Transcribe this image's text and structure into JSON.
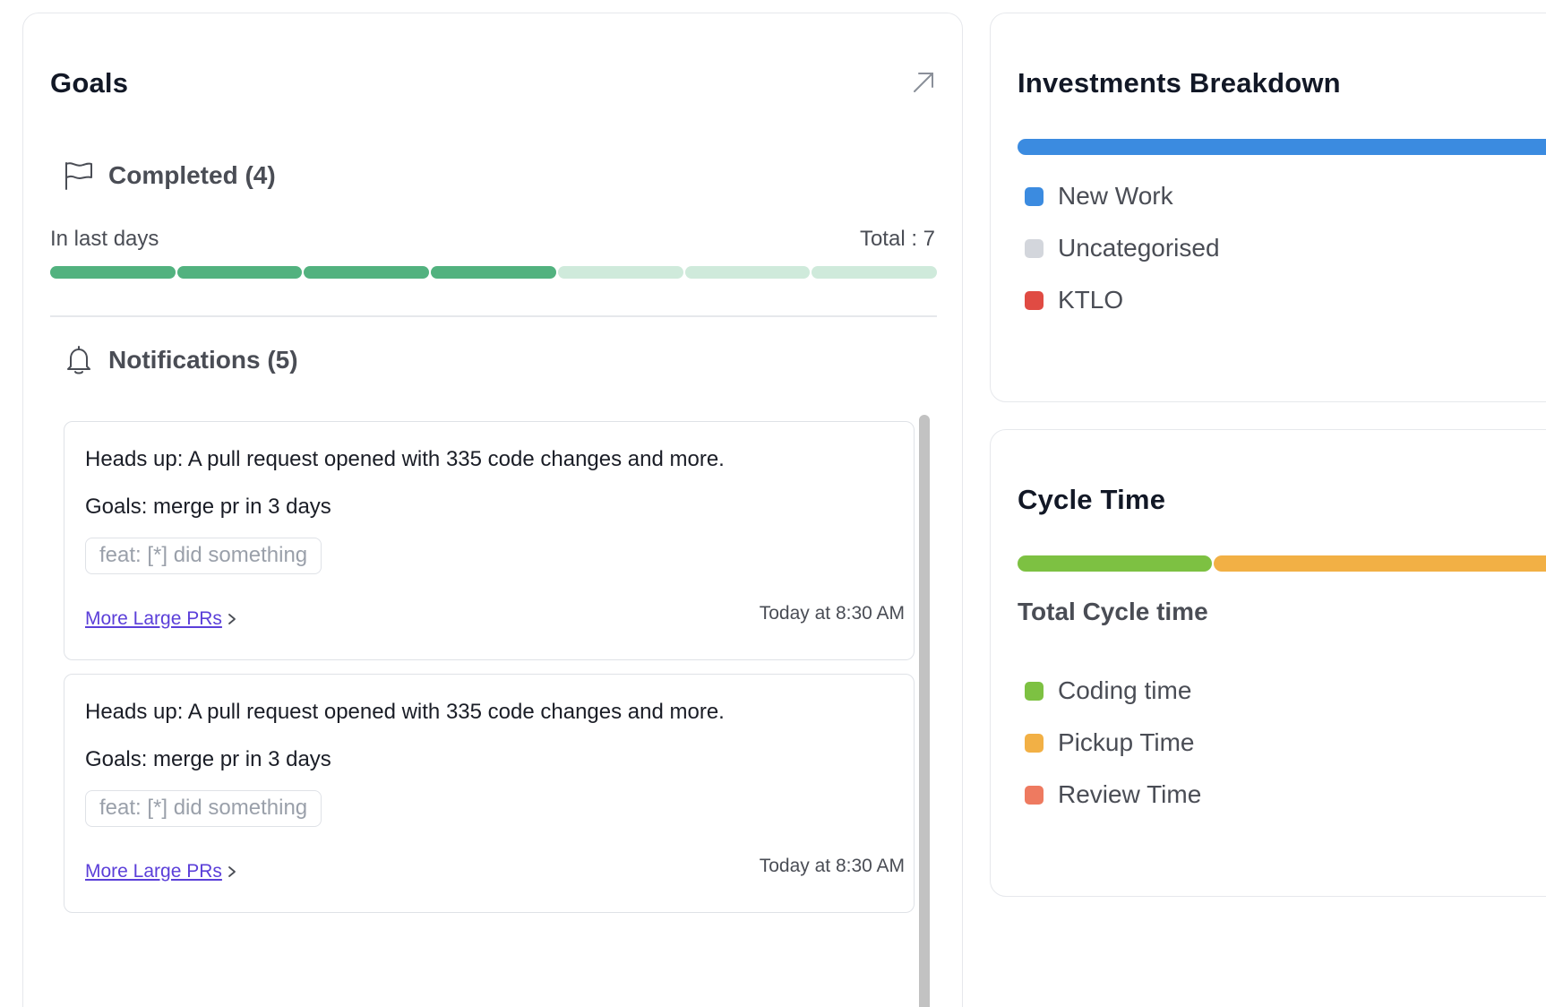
{
  "goals": {
    "title": "Goals",
    "completed": {
      "label": "Completed (4)",
      "in_last_days": "In last days",
      "total": "Total : 7",
      "completed_count": 4,
      "total_count": 7
    },
    "notifications": {
      "label": "Notifications (5)",
      "items": [
        {
          "message": "Heads up: A pull request opened with 335 code changes and more.",
          "goal": "Goals: merge pr in 3 days",
          "tag": "feat: [*] did something",
          "link": "More Large PRs",
          "time": "Today at 8:30 AM"
        },
        {
          "message": "Heads up: A pull request opened with 335 code changes and more.",
          "goal": "Goals: merge pr in 3 days",
          "tag": "feat: [*] did something",
          "link": "More Large PRs",
          "time": "Today at 8:30 AM"
        }
      ]
    }
  },
  "investments": {
    "title": "Investments Breakdown",
    "bar_color": "#3b8be0",
    "legend": [
      {
        "label": "New Work",
        "color": "#3b8be0"
      },
      {
        "label": "Uncategorised",
        "color": "#d3d6dc"
      },
      {
        "label": "KTLO",
        "color": "#e04b43"
      }
    ]
  },
  "cycle_time": {
    "title": "Cycle Time",
    "subtitle": "Total Cycle time",
    "segments": [
      {
        "label": "Coding time",
        "color": "#7dc142",
        "fraction": 0.34
      },
      {
        "label": "Pickup Time",
        "color": "#f2b045",
        "fraction": 0.66
      }
    ],
    "legend": [
      {
        "label": "Coding time",
        "color": "#7dc142"
      },
      {
        "label": "Pickup Time",
        "color": "#f2b045"
      },
      {
        "label": "Review Time",
        "color": "#ee7a60"
      }
    ]
  },
  "colors": {
    "goal_done": "#52b27f",
    "goal_todo": "#cfeadb",
    "link": "#5b3fd9"
  },
  "icons": {
    "expand": "arrow-up-right-icon",
    "completed": "flag-icon",
    "notifications": "bell-icon",
    "link": "chevron-right-icon"
  }
}
